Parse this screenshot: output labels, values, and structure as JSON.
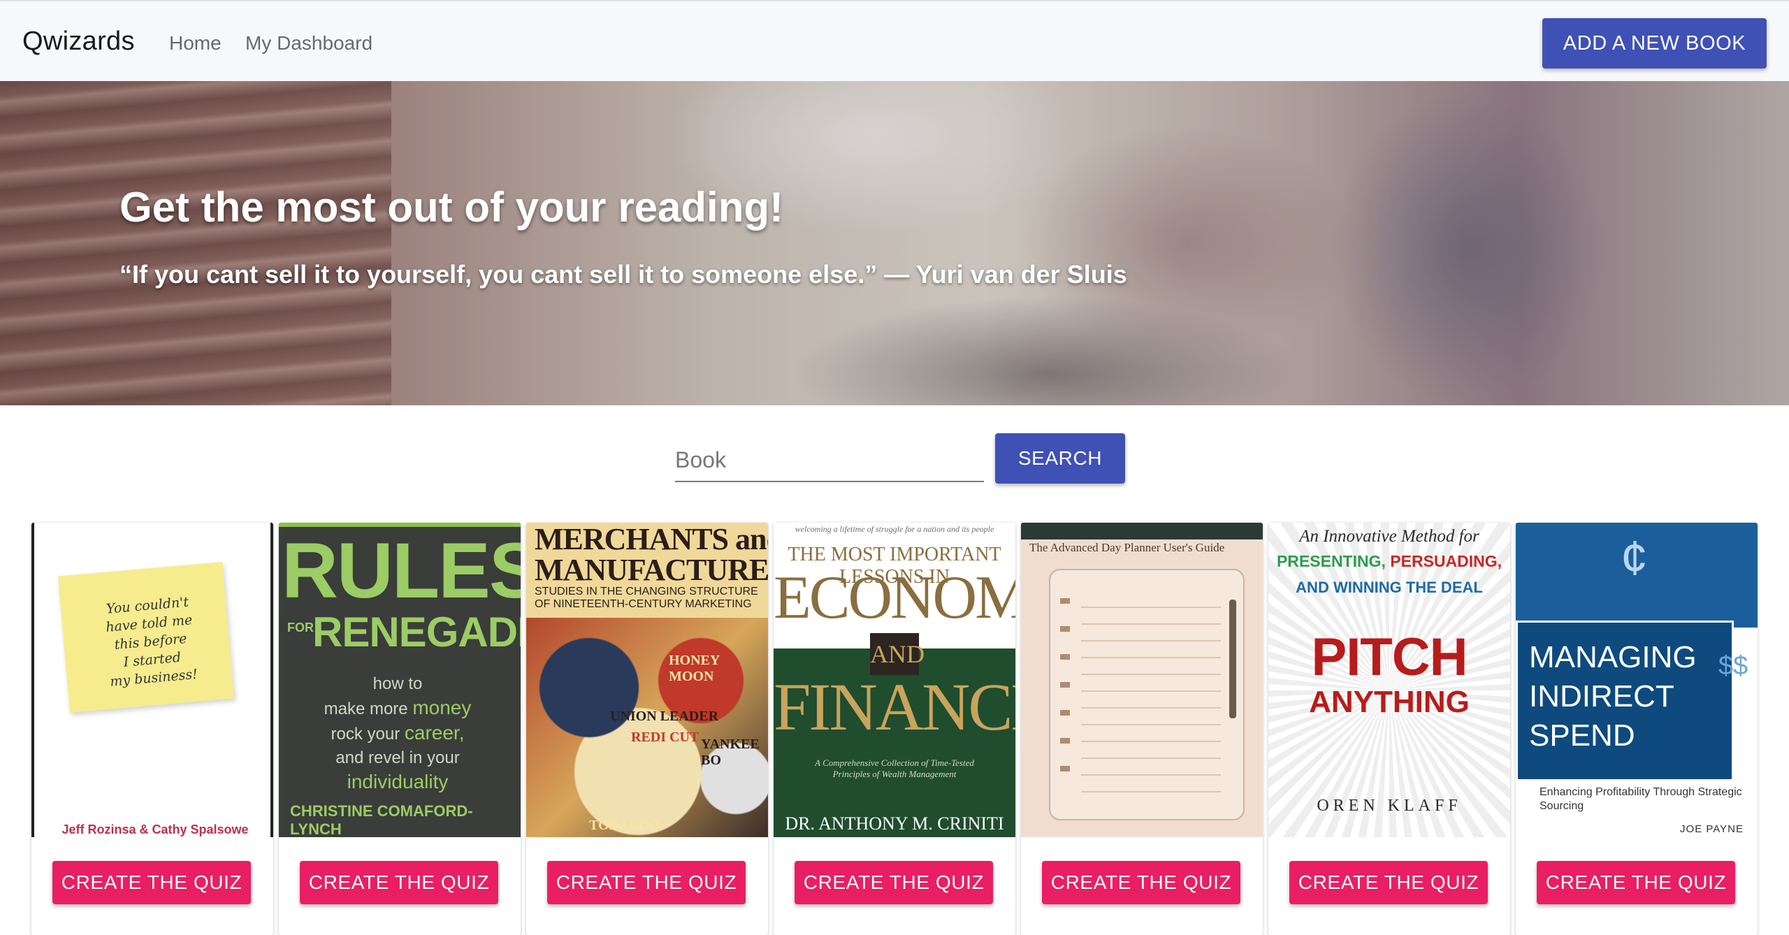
{
  "navbar": {
    "brand": "Qwizards",
    "links": [
      "Home",
      "My Dashboard"
    ],
    "add_book_label": "ADD A NEW BOOK"
  },
  "hero": {
    "title": "Get the most out of your reading!",
    "quote": "“If you cant sell it to yourself, you cant sell it to someone else.” — Yuri van der Sluis"
  },
  "search": {
    "placeholder": "Book",
    "value": "",
    "button_label": "SEARCH"
  },
  "books": [
    {
      "cover_lines": [
        "You couldn't",
        "have told me",
        "this before",
        "I started",
        "my business!"
      ],
      "author": "Jeff Rozinsa & Cathy Spalsowe",
      "quiz_label": "CREATE THE QUIZ"
    },
    {
      "title_a": "RULES",
      "title_for": "FOR",
      "title_b": "RENEGADES",
      "body": [
        "how to",
        "make more",
        "money",
        "rock your",
        "career,",
        "and revel in your",
        "individuality"
      ],
      "author": "CHRISTINE COMAFORD-LYNCH",
      "quiz_label": "CREATE THE QUIZ"
    },
    {
      "title": "MERCHANTS and MANUFACTURERS",
      "subtitle": "STUDIES IN THE CHANGING STRUCTURE OF NINETEENTH-CENTURY MARKETING",
      "labels": [
        "HONEY MOON",
        "UNION LEADER",
        "REDI CUT",
        "YANKEE BO",
        "TOBACCO"
      ],
      "quiz_label": "CREATE THE QUIZ"
    },
    {
      "tagline": "welcoming a lifetime of struggle for a nation and its people",
      "pre_title": "THE MOST IMPORTANT LESSONS IN",
      "title_a": "ECONOMICS",
      "title_and": "AND",
      "title_b": "FINANCE",
      "subtitle": "A Comprehensive Collection of Time-Tested Principles of Wealth Management",
      "author": "DR. ANTHONY M. CRINITI IV",
      "quiz_label": "CREATE THE QUIZ"
    },
    {
      "title": "The Advanced Day Planner User's Guide",
      "quiz_label": "CREATE THE QUIZ"
    },
    {
      "pre_title": "An Innovative Method for",
      "line_a": "PRESENTING,",
      "line_b": "PERSUADING,",
      "line_c": "AND WINNING THE DEAL",
      "title_a": "PITCH",
      "title_b": "ANYTHING",
      "author": "OREN KLAFF",
      "quiz_label": "CREATE THE QUIZ"
    },
    {
      "title_lines": [
        "MANAGING",
        "INDIRECT",
        "SPEND"
      ],
      "subtitle": "Enhancing Profitability Through Strategic Sourcing",
      "author": "JOE PAYNE",
      "quiz_label": "CREATE THE QUIZ"
    }
  ],
  "colors": {
    "primary": "#3f51b5",
    "accent": "#e91e63",
    "navbar_bg": "#f7f8fa"
  }
}
